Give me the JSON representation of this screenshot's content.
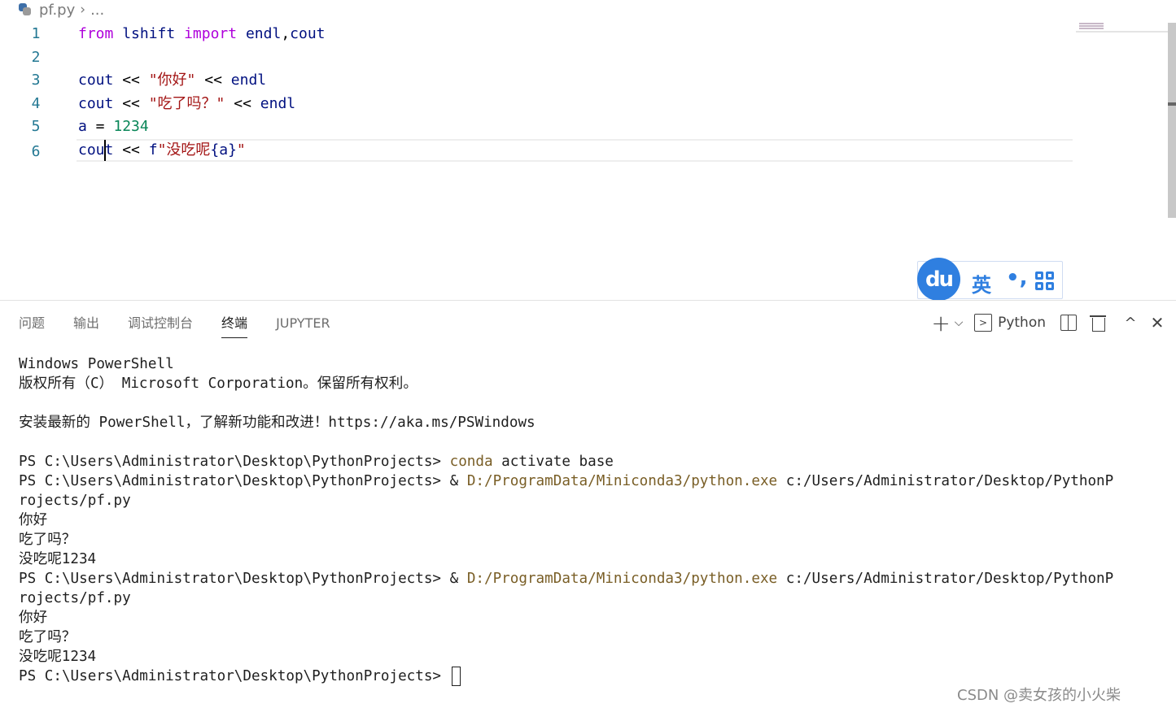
{
  "editor": {
    "breadcrumb": {
      "file": "pf.py",
      "more": "..."
    },
    "lines": [
      {
        "n": "1",
        "tokens": [
          [
            "kw",
            "from"
          ],
          [
            "op",
            " "
          ],
          [
            "id",
            "lshift"
          ],
          [
            "op",
            " "
          ],
          [
            "kw",
            "import"
          ],
          [
            "op",
            " "
          ],
          [
            "id",
            "endl"
          ],
          [
            "op",
            ","
          ],
          [
            "id",
            "cout"
          ]
        ]
      },
      {
        "n": "2",
        "tokens": []
      },
      {
        "n": "3",
        "tokens": [
          [
            "id",
            "cout"
          ],
          [
            "op",
            " << "
          ],
          [
            "str",
            "\"你好\""
          ],
          [
            "op",
            " << "
          ],
          [
            "id",
            "endl"
          ]
        ]
      },
      {
        "n": "4",
        "tokens": [
          [
            "id",
            "cout"
          ],
          [
            "op",
            " << "
          ],
          [
            "str",
            "\"吃了吗？\""
          ],
          [
            "op",
            " << "
          ],
          [
            "id",
            "endl"
          ]
        ]
      },
      {
        "n": "5",
        "tokens": [
          [
            "id",
            "a"
          ],
          [
            "op",
            " = "
          ],
          [
            "num",
            "1234"
          ]
        ]
      },
      {
        "n": "6",
        "tokens": [
          [
            "id",
            "cou"
          ],
          [
            "cursor",
            ""
          ],
          [
            "id",
            "t"
          ],
          [
            "op",
            " << "
          ],
          [
            "id",
            "f"
          ],
          [
            "str",
            "\"没吃呢"
          ],
          [
            "id",
            "{a}"
          ],
          [
            "str",
            "\""
          ]
        ]
      }
    ],
    "current_line": "6"
  },
  "ime": {
    "logo": "du",
    "language": "英",
    "punct": "•,",
    "grid_icon": "grid-icon"
  },
  "panel": {
    "tabs": [
      {
        "label": "问题",
        "active": false
      },
      {
        "label": "输出",
        "active": false
      },
      {
        "label": "调试控制台",
        "active": false
      },
      {
        "label": "终端",
        "active": true
      },
      {
        "label": "JUPYTER",
        "active": false
      }
    ],
    "actions": {
      "new_terminal": "+",
      "dropdown": "⌵",
      "profile_label": "Python",
      "maximize": "^",
      "close": "✕"
    }
  },
  "terminal": {
    "lines": [
      [
        [
          "t",
          "Windows PowerShell"
        ]
      ],
      [
        [
          "t",
          "版权所有（C） Microsoft Corporation。保留所有权利。"
        ]
      ],
      [],
      [
        [
          "t",
          "安装最新的 PowerShell，了解新功能和改进！https://aka.ms/PSWindows"
        ]
      ],
      [],
      [
        [
          "t",
          "PS C:\\Users\\Administrator\\Desktop\\PythonProjects> "
        ],
        [
          "c",
          "conda"
        ],
        [
          "t",
          " activate base"
        ]
      ],
      [
        [
          "t",
          "PS C:\\Users\\Administrator\\Desktop\\PythonProjects> & "
        ],
        [
          "c",
          "D:/ProgramData/Miniconda3/python.exe"
        ],
        [
          "t",
          " c:/Users/Administrator/Desktop/PythonP"
        ]
      ],
      [
        [
          "t",
          "rojects/pf.py"
        ]
      ],
      [
        [
          "t",
          "你好"
        ]
      ],
      [
        [
          "t",
          "吃了吗？"
        ]
      ],
      [
        [
          "t",
          "没吃呢1234"
        ]
      ],
      [
        [
          "t",
          "PS C:\\Users\\Administrator\\Desktop\\PythonProjects> & "
        ],
        [
          "c",
          "D:/ProgramData/Miniconda3/python.exe"
        ],
        [
          "t",
          " c:/Users/Administrator/Desktop/PythonP"
        ]
      ],
      [
        [
          "t",
          "rojects/pf.py"
        ]
      ],
      [
        [
          "t",
          "你好"
        ]
      ],
      [
        [
          "t",
          "吃了吗？"
        ]
      ],
      [
        [
          "t",
          "没吃呢1234"
        ]
      ],
      [
        [
          "t",
          "PS C:\\Users\\Administrator\\Desktop\\PythonProjects> "
        ],
        [
          "cursor",
          ""
        ]
      ]
    ]
  },
  "watermark": "CSDN @卖女孩的小火柴"
}
